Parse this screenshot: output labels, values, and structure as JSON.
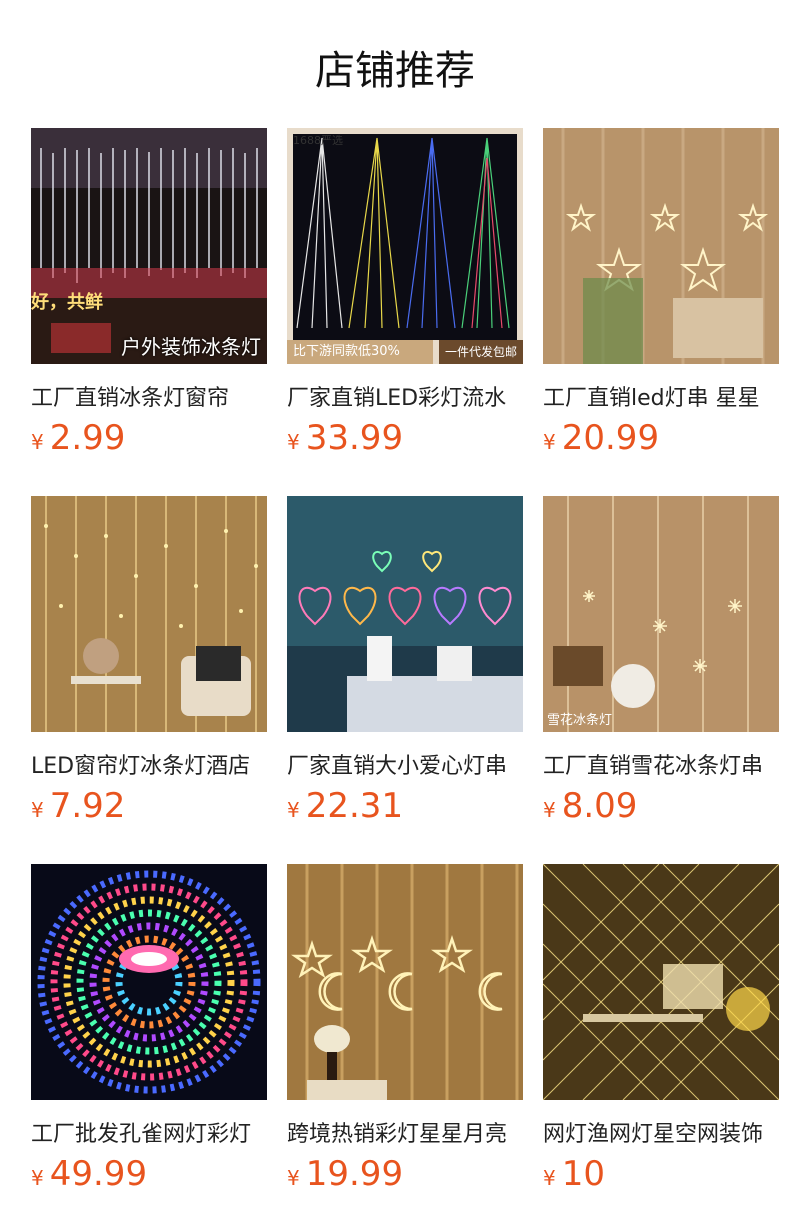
{
  "page": {
    "title": "店铺推荐"
  },
  "products": [
    {
      "name": "工厂直销冰条灯窗帘",
      "currency": "¥",
      "price": "2.99",
      "overlay": "户外装饰冰条灯",
      "overlay_left": "好，共鲜",
      "icon": "icicle-lights-image"
    },
    {
      "name": "厂家直销LED彩灯流水",
      "currency": "¥",
      "price": "33.99",
      "badge_top": "1688严选",
      "badge_left": "比下游同款低30%",
      "badge_right": "一件代发包邮",
      "icon": "waterfall-lights-image"
    },
    {
      "name": "工厂直销led灯串 星星",
      "currency": "¥",
      "price": "20.99",
      "icon": "star-curtain-image"
    },
    {
      "name": "LED窗帘灯冰条灯酒店",
      "currency": "¥",
      "price": "7.92",
      "icon": "curtain-lights-image"
    },
    {
      "name": "厂家直销大小爱心灯串",
      "currency": "¥",
      "price": "22.31",
      "icon": "heart-lights-image"
    },
    {
      "name": "工厂直销雪花冰条灯串",
      "currency": "¥",
      "price": "8.09",
      "overlay": "雪花冰条灯",
      "icon": "snowflake-lights-image"
    },
    {
      "name": "工厂批发孔雀网灯彩灯",
      "currency": "¥",
      "price": "49.99",
      "icon": "peacock-net-lights-image"
    },
    {
      "name": "跨境热销彩灯星星月亮",
      "currency": "¥",
      "price": "19.99",
      "icon": "star-moon-lights-image"
    },
    {
      "name": "网灯渔网灯星空网装饰",
      "currency": "¥",
      "price": "10",
      "icon": "net-lights-image"
    }
  ],
  "colors": {
    "price": "#e8541e",
    "title": "#111111"
  }
}
